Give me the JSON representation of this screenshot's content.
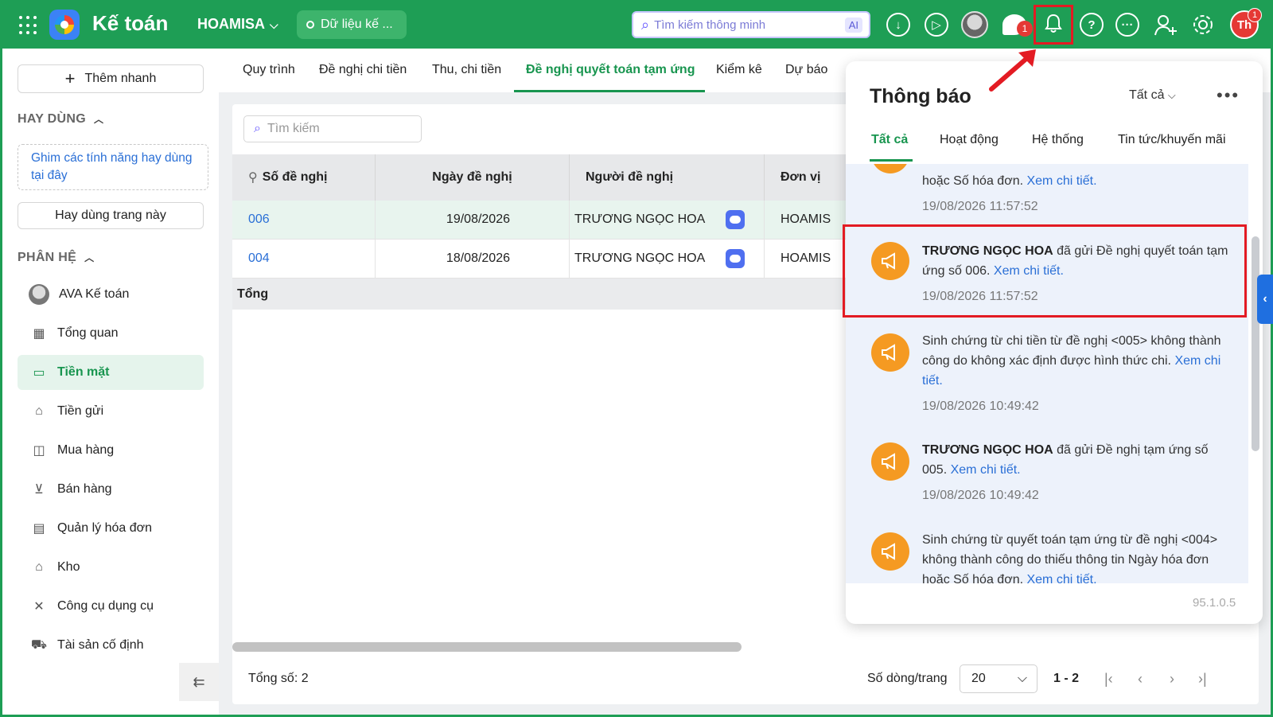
{
  "topbar": {
    "app_title": "Kế toán",
    "company": "HOAMISA",
    "data_pill": "Dữ liệu kế ...",
    "search_placeholder": "Tìm kiếm thông minh",
    "ai_badge": "AI",
    "chat_badge": "1",
    "user_initials": "Th",
    "user_badge": "1"
  },
  "sidebar": {
    "quick_add": "Thêm nhanh",
    "favorites_title": "HAY DÙNG",
    "pin_hint": "Ghim các tính năng hay dùng tại đây",
    "favorite_page_button": "Hay dùng trang này",
    "modules_title": "PHÂN HỆ",
    "items": [
      {
        "label": "AVA Kế toán",
        "icon": "avatar"
      },
      {
        "label": "Tổng quan",
        "icon": "dashboard-icon"
      },
      {
        "label": "Tiền mặt",
        "icon": "cash-icon",
        "active": true
      },
      {
        "label": "Tiền gửi",
        "icon": "bank-icon"
      },
      {
        "label": "Mua hàng",
        "icon": "bag-icon"
      },
      {
        "label": "Bán hàng",
        "icon": "cart-icon"
      },
      {
        "label": "Quản lý hóa đơn",
        "icon": "invoice-icon"
      },
      {
        "label": "Kho",
        "icon": "warehouse-icon"
      },
      {
        "label": "Công cụ dụng cụ",
        "icon": "tools-icon"
      },
      {
        "label": "Tài sản cố định",
        "icon": "car-icon"
      }
    ]
  },
  "tabs": [
    {
      "label": "Quy trình"
    },
    {
      "label": "Đề nghị chi tiền"
    },
    {
      "label": "Thu, chi tiền"
    },
    {
      "label": "Đề nghị quyết toán tạm ứng",
      "active": true
    },
    {
      "label": "Kiểm kê"
    },
    {
      "label": "Dự báo"
    }
  ],
  "search": {
    "placeholder": "Tìm kiếm"
  },
  "table": {
    "columns": [
      "Số đề nghị",
      "Ngày đề nghị",
      "Người đề nghị",
      "Đơn vị"
    ],
    "rows": [
      {
        "so": "006",
        "ngay": "19/08/2026",
        "nguoi": "TRƯƠNG NGỌC HOA",
        "don_vi": "HOAMIS"
      },
      {
        "so": "004",
        "ngay": "18/08/2026",
        "nguoi": "TRƯƠNG NGỌC HOA",
        "don_vi": "HOAMIS"
      }
    ],
    "total_label": "Tổng"
  },
  "footer": {
    "total": "Tổng số: 2",
    "rows_per_page_label": "Số dòng/trang",
    "rows_per_page": "20",
    "range": "1 - 2"
  },
  "notifications": {
    "title": "Thông báo",
    "filter": "Tất cả",
    "tabs": [
      "Tất cả",
      "Hoạt động",
      "Hệ thống",
      "Tin tức/khuyến mãi"
    ],
    "items": [
      {
        "text": "hoặc Số hóa đơn.",
        "link": "Xem chi tiết.",
        "time": "19/08/2026 11:57:52"
      },
      {
        "sender": "TRƯƠNG NGỌC HOA",
        "text": "đã gửi Đề nghị quyết toán tạm ứng số 006.",
        "link": "Xem chi tiết.",
        "time": "19/08/2026 11:57:52"
      },
      {
        "text": "Sinh chứng từ chi tiền từ đề nghị <005> không thành công do không xác định được hình thức chi.",
        "link": "Xem chi tiết.",
        "time": "19/08/2026 10:49:42"
      },
      {
        "sender": "TRƯƠNG NGỌC HOA",
        "text": "đã gửi Đề nghị tạm ứng số 005.",
        "link": "Xem chi tiết.",
        "time": "19/08/2026 10:49:42"
      },
      {
        "text": "Sinh chứng từ quyết toán tạm ứng từ đề nghị <004> không thành công do thiếu thông tin Ngày hóa đơn hoặc Số hóa đơn.",
        "link": "Xem chi tiết.",
        "time": ""
      }
    ],
    "version": "95.1.0.5"
  },
  "colors": {
    "brand": "#1e9e55",
    "accent": "#18954f",
    "link": "#2a6fd6",
    "alert": "#e31b23"
  }
}
